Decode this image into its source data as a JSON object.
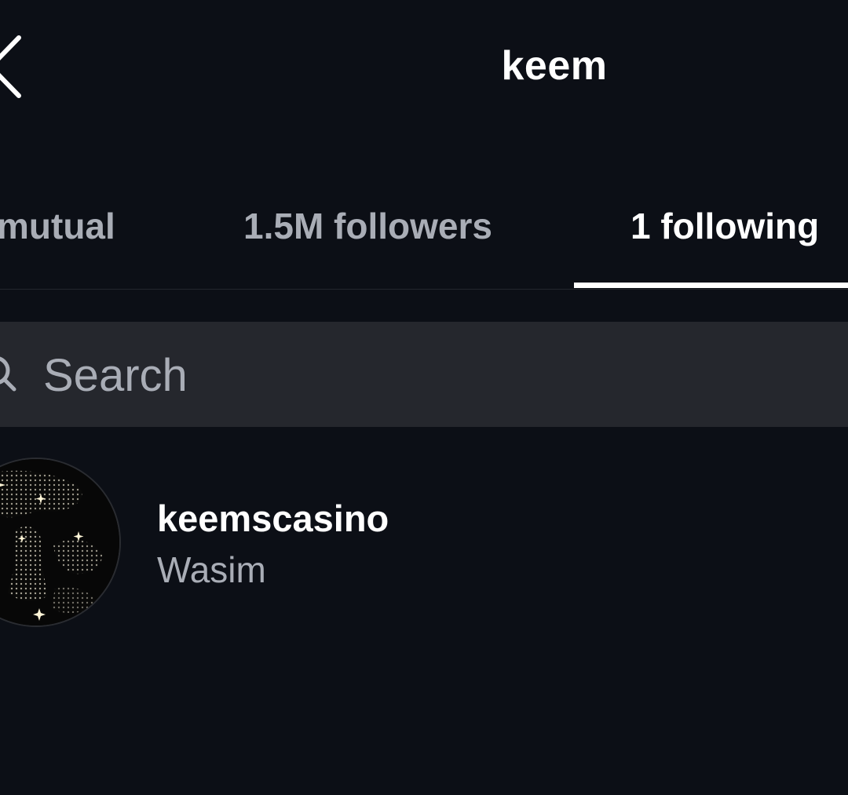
{
  "header": {
    "title": "keem"
  },
  "tabs": [
    {
      "label": "mutual",
      "active": false
    },
    {
      "label": "1.5M followers",
      "active": false
    },
    {
      "label": "1 following",
      "active": true
    }
  ],
  "search": {
    "placeholder": "Search",
    "value": ""
  },
  "list": {
    "items": [
      {
        "username": "keemscasino",
        "full_name": "Wasim"
      }
    ]
  },
  "icons": {
    "back": "chevron-left-icon",
    "search": "search-icon",
    "avatar": "avatar"
  },
  "colors": {
    "background": "#0c0f16",
    "search_bg": "#25272d",
    "active_text": "#ffffff",
    "inactive_text": "#a9adb6"
  }
}
